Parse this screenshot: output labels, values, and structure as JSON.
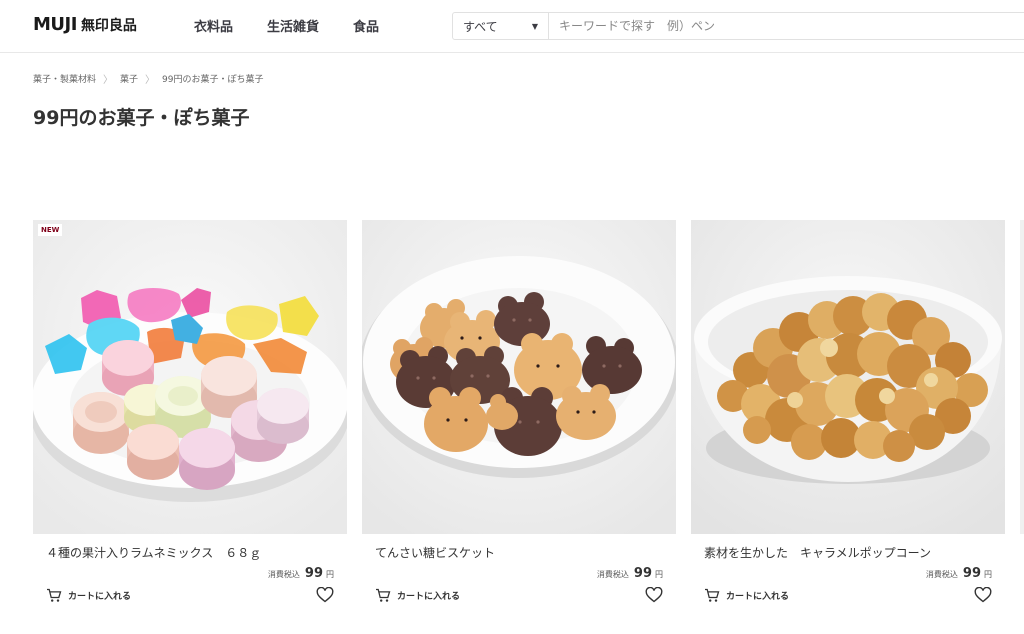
{
  "header": {
    "logo_text": "MUJI",
    "logo_jp": "無印良品",
    "nav": [
      "衣料品",
      "生活雑貨",
      "食品"
    ],
    "search_scope": "すべて",
    "search_placeholder": "キーワードで探す　例）ペン"
  },
  "breadcrumb": [
    "菓子・製菓材料",
    "菓子",
    "99円のお菓子・ぽち菓子"
  ],
  "page_title": "99円のお菓子・ぽち菓子",
  "products": [
    {
      "badge": "NEW",
      "name": "４種の果汁入りラムネミックス　６８ｇ",
      "tax_label": "消費税込",
      "price": "99",
      "currency": "円",
      "cart_label": "カートに入れる"
    },
    {
      "name": "てんさい糖ビスケット",
      "tax_label": "消費税込",
      "price": "99",
      "currency": "円",
      "cart_label": "カートに入れる"
    },
    {
      "name": "素材を生かした　キャラメルポップコーン",
      "tax_label": "消費税込",
      "price": "99",
      "currency": "円",
      "cart_label": "カートに入れる"
    }
  ],
  "icons": {
    "cart": "cart-icon",
    "heart": "heart-icon",
    "caret": "caret-down-icon",
    "separator": "chevron-right-icon"
  },
  "colors": {
    "badge": "#7f0019",
    "text": "#3c3c43"
  }
}
